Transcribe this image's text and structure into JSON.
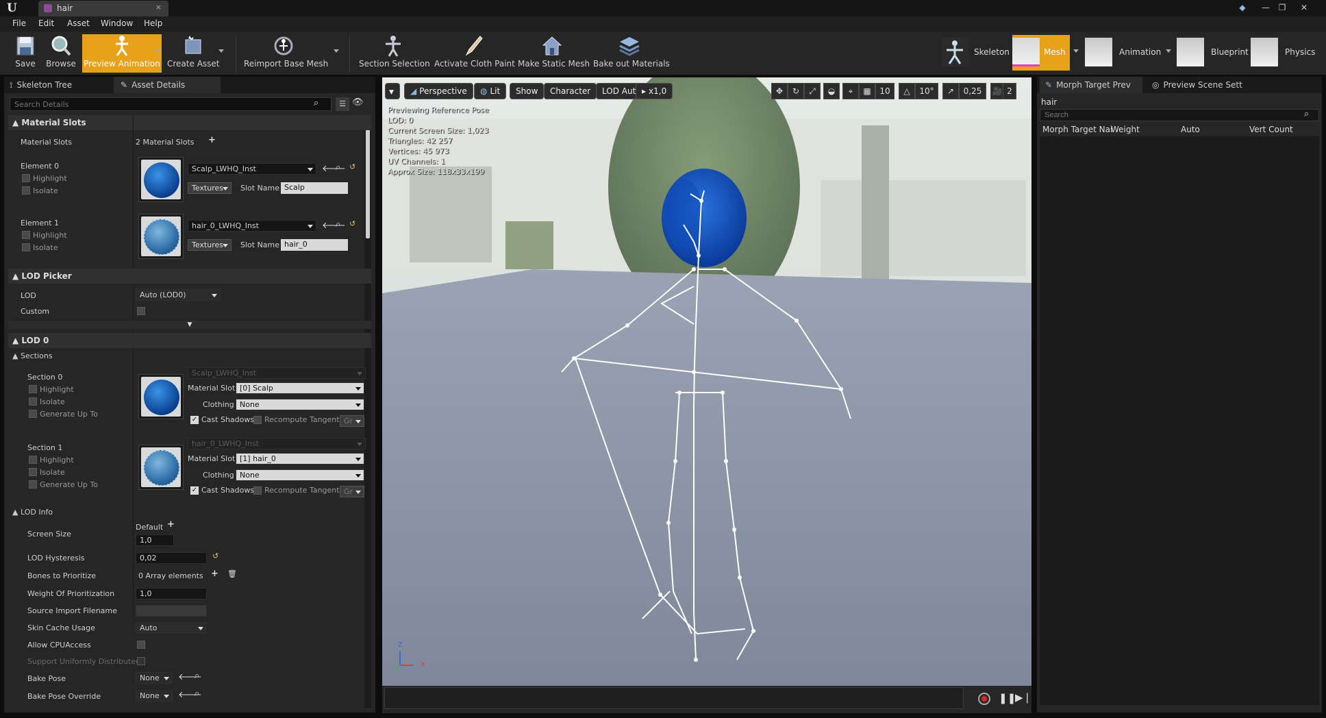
{
  "window": {
    "tab_title": "hair",
    "tab_close": "×",
    "min": "—",
    "max": "❐",
    "close": "✕"
  },
  "menu": [
    "File",
    "Edit",
    "Asset",
    "Window",
    "Help"
  ],
  "toolbar": {
    "save": "Save",
    "browse": "Browse",
    "preview_animation": "Preview Animation",
    "create_asset": "Create Asset",
    "reimport": "Reimport Base Mesh",
    "section_selection": "Section Selection",
    "activate_cloth_paint": "Activate Cloth Paint",
    "make_static_mesh": "Make Static Mesh",
    "bake_out_materials": "Bake out Materials",
    "modes": [
      "Skeleton",
      "Mesh",
      "Animation",
      "Blueprint",
      "Physics"
    ]
  },
  "left_panel": {
    "tabs": [
      "Skeleton Tree",
      "Asset Details"
    ],
    "search_placeholder": "Search Details",
    "material_slots": {
      "header": "Material Slots",
      "label": "Material Slots",
      "count": "2 Material Slots",
      "elements": [
        {
          "name": "Element 0",
          "highlight": "Highlight",
          "isolate": "Isolate",
          "material": "Scalp_LWHQ_Inst",
          "textures": "Textures",
          "slot_name_label": "Slot Name",
          "slot_name": "Scalp"
        },
        {
          "name": "Element 1",
          "highlight": "Highlight",
          "isolate": "Isolate",
          "material": "hair_0_LWHQ_Inst",
          "textures": "Textures",
          "slot_name_label": "Slot Name",
          "slot_name": "hair_0"
        }
      ]
    },
    "lod_picker": {
      "header": "LOD Picker",
      "lod_label": "LOD",
      "lod_value": "Auto (LOD0)",
      "custom_label": "Custom"
    },
    "lod0": {
      "header": "LOD 0",
      "sections_header": "Sections",
      "sections": [
        {
          "name": "Section 0",
          "highlight": "Highlight",
          "isolate": "Isolate",
          "generate": "Generate Up To",
          "material": "Scalp_LWHQ_Inst",
          "material_slot_label": "Material Slot",
          "material_slot": "[0] Scalp",
          "clothing_label": "Clothing",
          "clothing": "None",
          "cast_shadows": "Cast Shadows",
          "recompute": "Recompute Tangent",
          "gr": "Gr"
        },
        {
          "name": "Section 1",
          "highlight": "Highlight",
          "isolate": "Isolate",
          "generate": "Generate Up To",
          "material": "hair_0_LWHQ_Inst",
          "material_slot_label": "Material Slot",
          "material_slot": "[1] hair_0",
          "clothing_label": "Clothing",
          "clothing": "None",
          "cast_shadows": "Cast Shadows",
          "recompute": "Recompute Tangent",
          "gr": "Gr"
        }
      ],
      "lod_info": {
        "header": "LOD Info",
        "screen_size_label": "Screen Size",
        "screen_size_default": "Default",
        "screen_size": "1,0",
        "hysteresis_label": "LOD Hysteresis",
        "hysteresis": "0,02",
        "bones_label": "Bones to Prioritize",
        "bones": "0 Array elements",
        "weight_label": "Weight Of Prioritization",
        "weight": "1,0",
        "source_label": "Source Import Filename",
        "skin_cache_label": "Skin Cache Usage",
        "skin_cache": "Auto",
        "allow_cpu_label": "Allow CPUAccess",
        "support_label": "Support Uniformly Distributed",
        "bake_pose_label": "Bake Pose",
        "bake_pose": "None",
        "bake_override_label": "Bake Pose Override",
        "bake_override": "None"
      }
    }
  },
  "viewport": {
    "toolbar": {
      "perspective": "Perspective",
      "lit": "Lit",
      "show": "Show",
      "character": "Character",
      "lod": "LOD Auto",
      "speed": "x1,0",
      "grid": "10",
      "rot": "10°",
      "scale": "0,25",
      "cam": "2"
    },
    "stats": [
      "Previewing Reference Pose",
      "LOD: 0",
      "Current Screen Size: 1,023",
      "Triangles: 42 257",
      "Vertices: 45 973",
      "UV Channels: 1",
      "Approx Size: 118x33x199"
    ],
    "axis_z": "Z",
    "axis_x": "X"
  },
  "right_panel": {
    "tabs": [
      "Morph Target Prev",
      "Preview Scene Sett"
    ],
    "title": "hair",
    "search_placeholder": "Search",
    "columns": [
      "Morph Target Nai",
      "Weight",
      "Auto",
      "Vert Count"
    ]
  },
  "colors": {
    "accent": "#e8a21a",
    "mesh_mode": "#e8a21a",
    "hair": "#1a56c9"
  }
}
